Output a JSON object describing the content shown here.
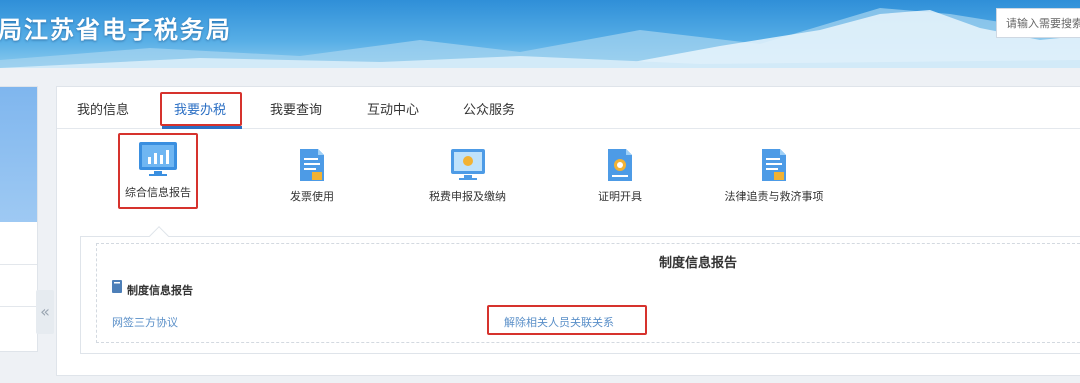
{
  "header": {
    "site_title": "局江苏省电子税务局",
    "search_placeholder": "请输入需要搜索"
  },
  "tabs": [
    {
      "label": "我的信息"
    },
    {
      "label": "我要办税"
    },
    {
      "label": "我要查询"
    },
    {
      "label": "互动中心"
    },
    {
      "label": "公众服务"
    }
  ],
  "functions": [
    {
      "label": "综合信息报告",
      "icon": "monitor-chart-icon"
    },
    {
      "label": "发票使用",
      "icon": "document-icon"
    },
    {
      "label": "税费申报及缴纳",
      "icon": "monitor-icon"
    },
    {
      "label": "证明开具",
      "icon": "certificate-icon"
    },
    {
      "label": "法律追责与救济事项",
      "icon": "document-icon"
    }
  ],
  "subpanel": {
    "title": "制度信息报告",
    "section_heading": "制度信息报告",
    "links": [
      "网签三方协议",
      "解除相关人员关联关系"
    ]
  },
  "collapse_glyph": "«",
  "colors": {
    "accent": "#2b6fc4",
    "highlight": "#d6322d",
    "link": "#5a8fc8"
  }
}
